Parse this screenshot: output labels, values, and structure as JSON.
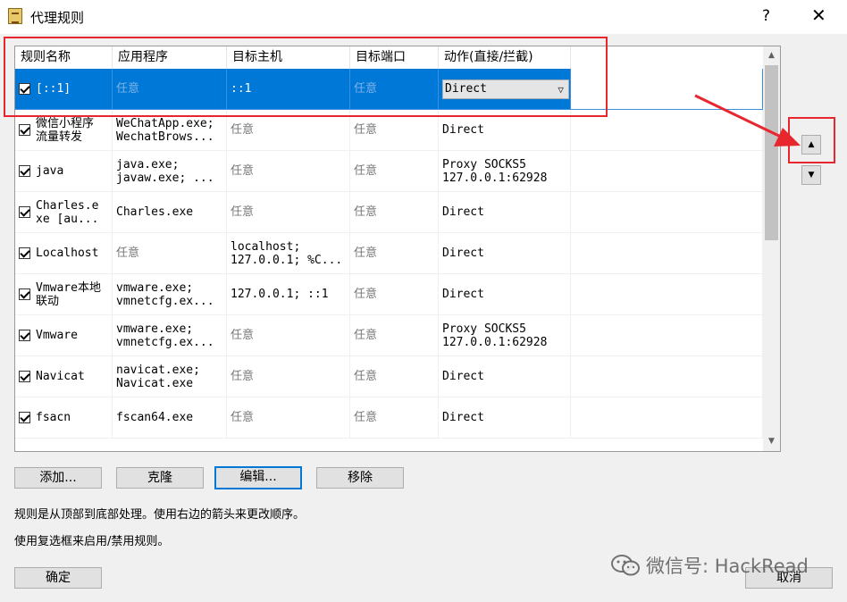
{
  "window": {
    "title": "代理规则",
    "help": "?",
    "close": "✕"
  },
  "table": {
    "columns": [
      "规则名称",
      "应用程序",
      "目标主机",
      "目标端口",
      "动作(直接/拦截)"
    ],
    "rows": [
      {
        "name": "[::1]",
        "apps": "任意",
        "hosts": "::1",
        "ports": "任意",
        "action": "Direct",
        "checked": true,
        "selected": true
      },
      {
        "name": "微信小程序\n流量转发",
        "apps": "WeChatApp.exe;\nWechatBrows...",
        "hosts": "任意",
        "ports": "任意",
        "action": "Direct",
        "checked": true
      },
      {
        "name": "java",
        "apps": "java.exe;\njavaw.exe; ...",
        "hosts": "任意",
        "ports": "任意",
        "action": "Proxy SOCKS5\n127.0.0.1:62928",
        "checked": true
      },
      {
        "name": "Charles.e\nxe [au...",
        "apps": "Charles.exe",
        "hosts": "任意",
        "ports": "任意",
        "action": "Direct",
        "checked": true
      },
      {
        "name": "Localhost",
        "apps": "任意",
        "hosts": "localhost;\n127.0.0.1; %C...",
        "ports": "任意",
        "action": "Direct",
        "checked": true
      },
      {
        "name": "Vmware本地\n联动",
        "apps": "vmware.exe;\nvmnetcfg.ex...",
        "hosts": "127.0.0.1; ::1",
        "ports": "任意",
        "action": "Direct",
        "checked": true
      },
      {
        "name": "Vmware",
        "apps": "vmware.exe;\nvmnetcfg.ex...",
        "hosts": "任意",
        "ports": "任意",
        "action": "Proxy SOCKS5\n127.0.0.1:62928",
        "checked": true
      },
      {
        "name": "Navicat",
        "apps": "navicat.exe;\nNavicat.exe",
        "hosts": "任意",
        "ports": "任意",
        "action": "Direct",
        "checked": true
      },
      {
        "name": "fsacn",
        "apps": "fscan64.exe",
        "hosts": "任意",
        "ports": "任意",
        "action": "Direct",
        "checked": true
      }
    ]
  },
  "buttons": {
    "add": "添加...",
    "clone": "克隆",
    "edit": "编辑...",
    "remove": "移除",
    "ok": "确定",
    "cancel": "取消"
  },
  "info": {
    "line1": "规则是从顶部到底部处理。使用右边的箭头来更改顺序。",
    "line2": "使用复选框来启用/禁用规则。"
  },
  "watermark": "微信号: HackRead",
  "colors": {
    "selection": "#0078d7",
    "annotation": "#e8262d"
  }
}
